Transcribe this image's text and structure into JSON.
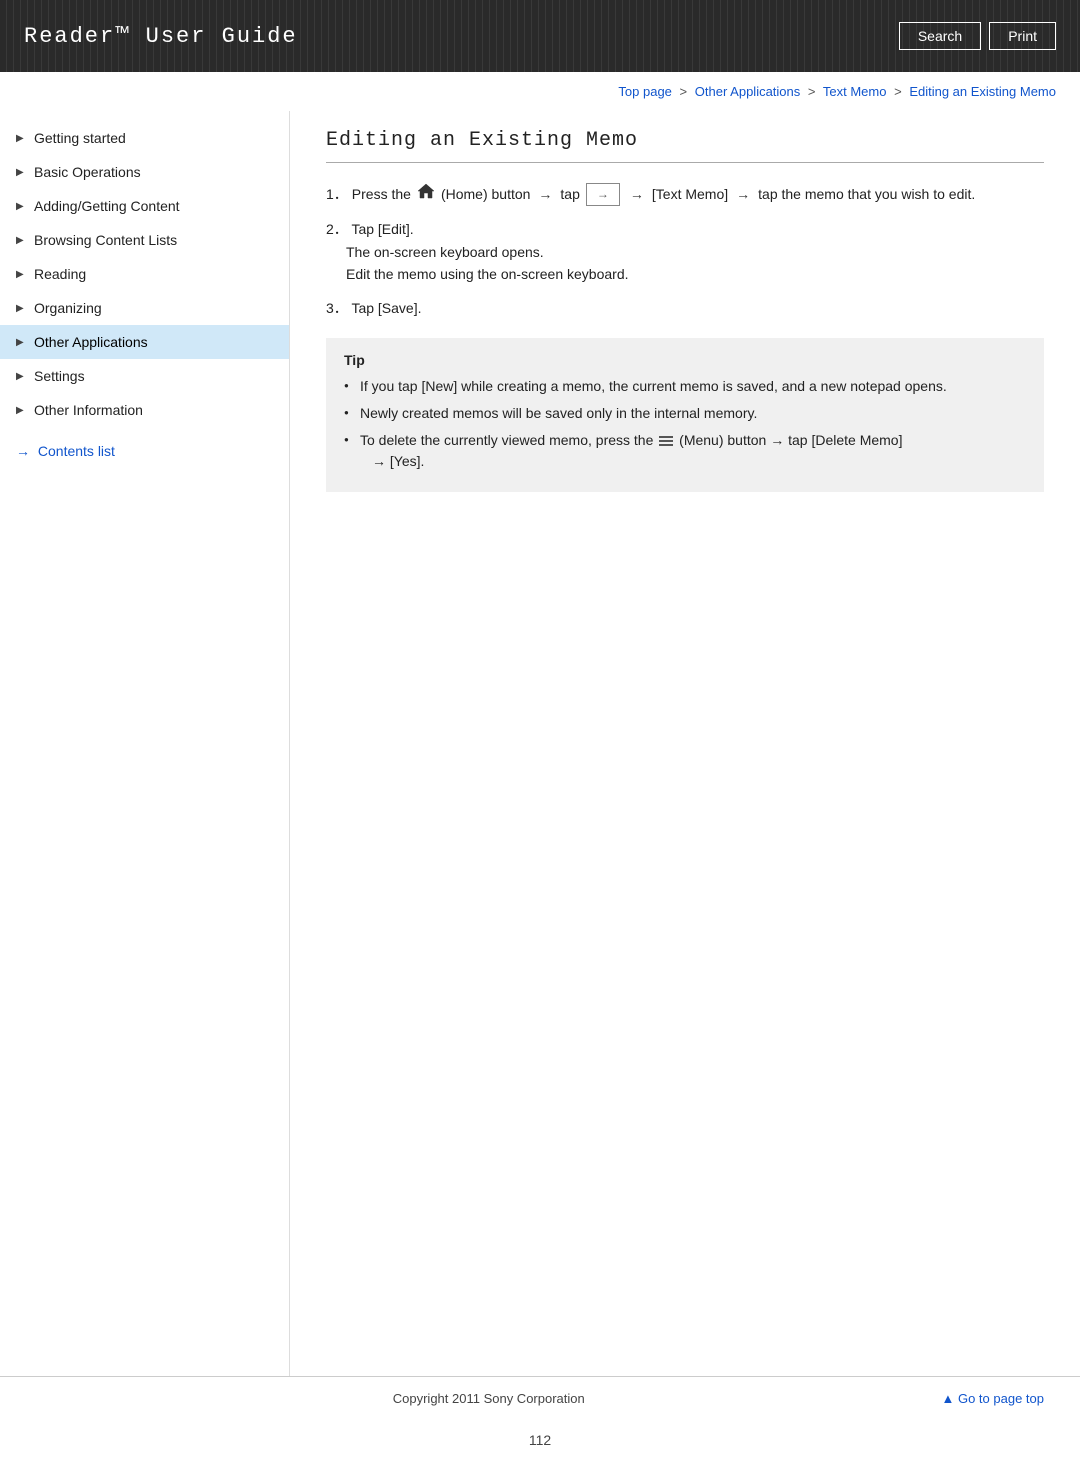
{
  "header": {
    "title": "Reader™ User Guide",
    "search_label": "Search",
    "print_label": "Print"
  },
  "breadcrumb": {
    "top_page": "Top page",
    "other_applications": "Other Applications",
    "text_memo": "Text Memo",
    "current": "Editing an Existing Memo",
    "sep": ">"
  },
  "sidebar": {
    "items": [
      {
        "id": "getting-started",
        "label": "Getting started",
        "active": false
      },
      {
        "id": "basic-operations",
        "label": "Basic Operations",
        "active": false
      },
      {
        "id": "adding-getting-content",
        "label": "Adding/Getting Content",
        "active": false
      },
      {
        "id": "browsing-content-lists",
        "label": "Browsing Content Lists",
        "active": false
      },
      {
        "id": "reading",
        "label": "Reading",
        "active": false
      },
      {
        "id": "organizing",
        "label": "Organizing",
        "active": false
      },
      {
        "id": "other-applications",
        "label": "Other Applications",
        "active": true
      },
      {
        "id": "settings",
        "label": "Settings",
        "active": false
      },
      {
        "id": "other-information",
        "label": "Other Information",
        "active": false
      }
    ],
    "contents_list_label": "Contents list"
  },
  "main": {
    "page_title": "Editing an Existing Memo",
    "steps": [
      {
        "num": "1",
        "text_before": "Press the",
        "home_icon": "home",
        "text_after_icon": "(Home) button",
        "arrow1": "→",
        "tap_text": "tap",
        "arrow_btn_label": "→",
        "arrow2": "→",
        "text_memo": "[Text Memo]",
        "arrow3": "→",
        "rest": "tap the memo that you wish to edit."
      },
      {
        "num": "2",
        "text": "Tap [Edit].",
        "sub1": "The on-screen keyboard opens.",
        "sub2": "Edit the memo using the on-screen keyboard."
      },
      {
        "num": "3",
        "text": "Tap [Save]."
      }
    ],
    "tip": {
      "title": "Tip",
      "bullets": [
        "If you tap [New] while creating a memo, the current memo is saved, and a new notepad opens.",
        "Newly created memos will be saved only in the internal memory.",
        "To delete the currently viewed memo, press the  (Menu) button → tap [Delete Memo] → [Yes]."
      ]
    }
  },
  "footer": {
    "copyright": "Copyright 2011 Sony Corporation",
    "go_to_top": "▲ Go to page top",
    "page_number": "112"
  }
}
